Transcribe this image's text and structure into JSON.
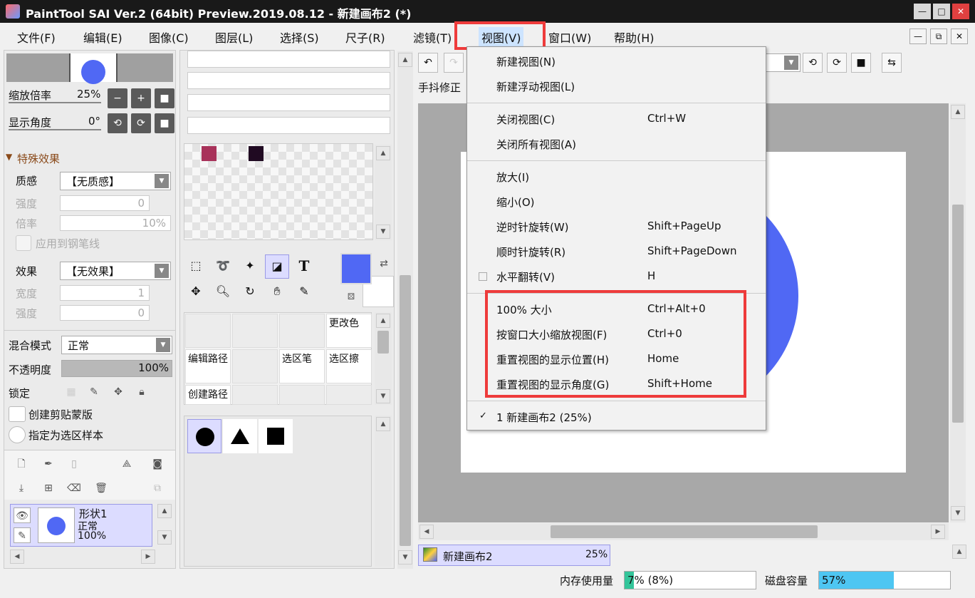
{
  "window": {
    "title": "PaintTool SAI Ver.2 (64bit) Preview.2019.08.12 - 新建画布2 (*)"
  },
  "menubar": {
    "items": [
      "文件(F)",
      "编辑(E)",
      "图像(C)",
      "图层(L)",
      "选择(S)",
      "尺子(R)",
      "滤镜(T)",
      "视图(V)",
      "窗口(W)",
      "帮助(H)"
    ]
  },
  "navigator": {
    "zoom_label": "缩放倍率",
    "zoom_value": "25%",
    "angle_label": "显示角度",
    "angle_value": "0°"
  },
  "effects": {
    "section_title": "特殊效果",
    "texture_label": "质感",
    "texture_value": "【无质感】",
    "strength_label": "强度",
    "strength_value": "0",
    "scale_label": "倍率",
    "scale_value": "10%",
    "apply_pen_label": "应用到钢笔线",
    "effect_label": "效果",
    "effect_value": "【无效果】",
    "width_label": "宽度",
    "width_value": "1",
    "strength2_label": "强度",
    "strength2_value": "0"
  },
  "layer_props": {
    "blend_label": "混合模式",
    "blend_value": "正常",
    "opacity_label": "不透明度",
    "opacity_value": "100%",
    "opacity_fraction": 1.0,
    "lock_label": "锁定",
    "clip_label": "创建剪贴蒙版",
    "sample_label": "指定为选区样本"
  },
  "layer": {
    "name": "形状1",
    "mode": "正常",
    "opacity": "100%"
  },
  "tool_grid": {
    "change_color": "更改色",
    "edit_path": "编辑路径",
    "select_pen": "选区笔",
    "select_eraser": "选区擦",
    "create_path": "创建路径"
  },
  "canvas_area": {
    "stabilizer_label": "手抖修正"
  },
  "view_menu": {
    "new_view": "新建视图(N)",
    "new_float_view": "新建浮动视图(L)",
    "close_view": "关闭视图(C)",
    "close_view_sc": "Ctrl+W",
    "close_all": "关闭所有视图(A)",
    "zoom_in": "放大(I)",
    "zoom_out": "缩小(O)",
    "rotate_ccw": "逆时针旋转(W)",
    "rotate_ccw_sc": "Shift+PageUp",
    "rotate_cw": "顺时针旋转(R)",
    "rotate_cw_sc": "Shift+PageDown",
    "flip_h": "水平翻转(V)",
    "flip_h_sc": "H",
    "actual_size": "100% 大小",
    "actual_size_sc": "Ctrl+Alt+0",
    "fit_window": "按窗口大小缩放视图(F)",
    "fit_window_sc": "Ctrl+0",
    "reset_pos": "重置视图的显示位置(H)",
    "reset_pos_sc": "Home",
    "reset_angle": "重置视图的显示角度(G)",
    "reset_angle_sc": "Shift+Home",
    "canvas_item": "1 新建画布2 (25%)"
  },
  "canvas_tab": {
    "name": "新建画布2",
    "zoom": "25%"
  },
  "status": {
    "mem_label": "内存使用量",
    "mem_value": "7% (8%)",
    "mem_fraction": 0.07,
    "disk_label": "磁盘容量",
    "disk_value": "57%",
    "disk_fraction": 0.57
  },
  "colors": {
    "primary": "#5068f4",
    "accent_red": "#ee3b3b",
    "swatch1": "#a8325a",
    "swatch2": "#200a22"
  }
}
